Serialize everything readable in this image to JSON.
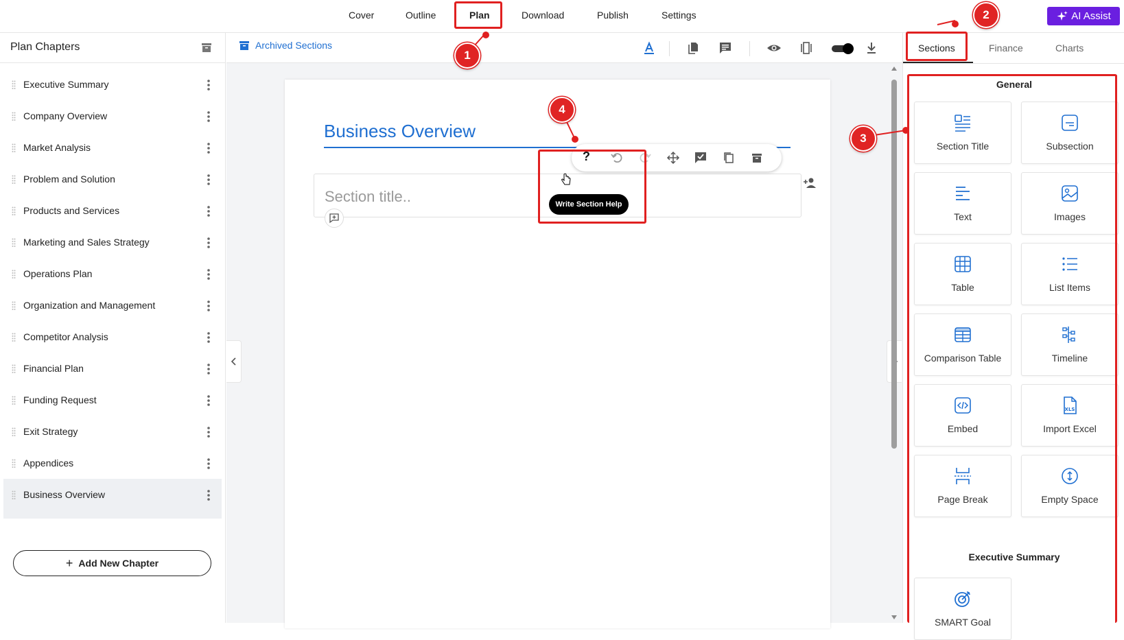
{
  "top_nav": {
    "tabs": [
      "Cover",
      "Outline",
      "Plan",
      "Download",
      "Publish",
      "Settings"
    ],
    "active_tab": "Plan",
    "ai_assist_label": "AI Assist"
  },
  "sidebar": {
    "title": "Plan Chapters",
    "chapters": [
      "Executive Summary",
      "Company Overview",
      "Market Analysis",
      "Problem and Solution",
      "Products and Services",
      "Marketing and Sales Strategy",
      "Operations Plan",
      "Organization and Management",
      "Competitor Analysis",
      "Financial Plan",
      "Funding Request",
      "Exit Strategy",
      "Appendices",
      "Business Overview"
    ],
    "active_chapter": "Business Overview",
    "add_button": "Add New Chapter"
  },
  "editor": {
    "archived_label": "Archived Sections",
    "doc_title": "Business Overview",
    "section_placeholder": "Section title..",
    "tooltip": "Write Section Help",
    "help_glyph": "?"
  },
  "right_panel": {
    "tabs": [
      "Sections",
      "Finance",
      "Charts"
    ],
    "active_tab": "Sections",
    "groups": [
      {
        "title": "General",
        "items": [
          "Section Title",
          "Subsection",
          "Text",
          "Images",
          "Table",
          "List Items",
          "Comparison Table",
          "Timeline",
          "Embed",
          "Import Excel",
          "Page Break",
          "Empty Space"
        ]
      },
      {
        "title": "Executive Summary",
        "items": [
          "SMART Goal"
        ]
      }
    ]
  },
  "annotations": [
    "1",
    "2",
    "3",
    "4"
  ],
  "colors": {
    "accent_blue": "#1f6fd1",
    "ai_purple": "#6a1fe0",
    "annotation_red": "#e02020"
  }
}
